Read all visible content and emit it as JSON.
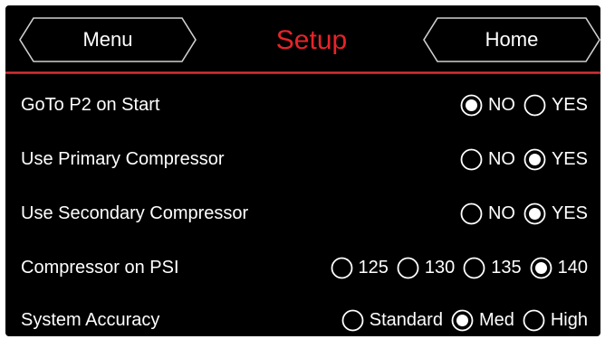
{
  "header": {
    "title": "Setup",
    "menu_label": "Menu",
    "home_label": "Home"
  },
  "colors": {
    "background": "#000000",
    "title": "#e8232a",
    "text": "#ffffff",
    "divider": "#c0282e"
  },
  "settings": [
    {
      "label": "GoTo P2 on Start",
      "options": [
        {
          "label": "NO",
          "selected": true
        },
        {
          "label": "YES",
          "selected": false
        }
      ]
    },
    {
      "label": "Use Primary Compressor",
      "options": [
        {
          "label": "NO",
          "selected": false
        },
        {
          "label": "YES",
          "selected": true
        }
      ]
    },
    {
      "label": "Use Secondary Compressor",
      "options": [
        {
          "label": "NO",
          "selected": false
        },
        {
          "label": "YES",
          "selected": true
        }
      ]
    },
    {
      "label": "Compressor on PSI",
      "options": [
        {
          "label": "125",
          "selected": false
        },
        {
          "label": "130",
          "selected": false
        },
        {
          "label": "135",
          "selected": false
        },
        {
          "label": "140",
          "selected": true
        }
      ]
    },
    {
      "label": "System Accuracy",
      "options": [
        {
          "label": "Standard",
          "selected": false
        },
        {
          "label": "Med",
          "selected": true
        },
        {
          "label": "High",
          "selected": false
        }
      ]
    }
  ]
}
